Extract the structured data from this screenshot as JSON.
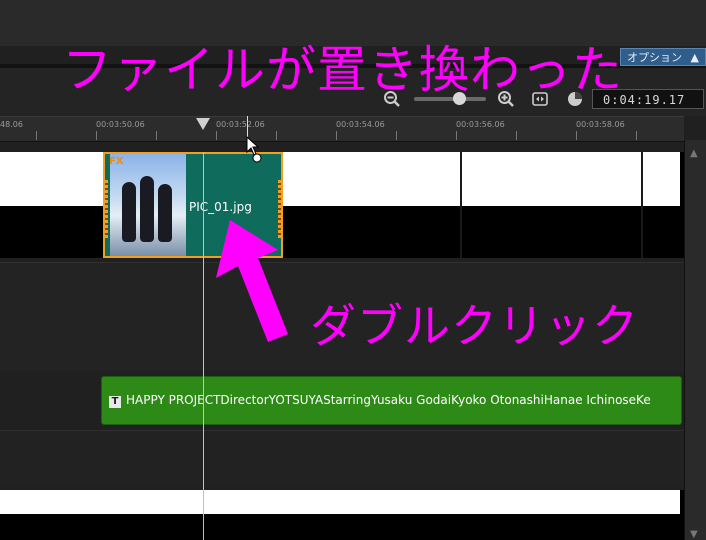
{
  "toolbar": {
    "options_label": "オプション",
    "timecode": "0:04:19.17"
  },
  "ruler": {
    "ticks": [
      "48.06",
      "00:03:50.06",
      "00:03:52.06",
      "00:03:54.06",
      "00:03:56.06",
      "00:03:58.06"
    ]
  },
  "clip": {
    "fx_label": "FX",
    "name": "PIC_01.jpg"
  },
  "title_clip": {
    "icon": "T",
    "text": "HAPPY PROJECTDirectorYOTSUYAStarringYusaku GodaiKyoko OtonashiHanae IchinoseKe"
  },
  "annotations": {
    "caption_top": "ファイルが置き換わった",
    "caption_mid": "ダブルクリック"
  },
  "colors": {
    "accent": "#ff00ff",
    "clip_fill": "#0f6b5b",
    "clip_border": "#f0a020",
    "title_clip": "#2d8a17"
  }
}
